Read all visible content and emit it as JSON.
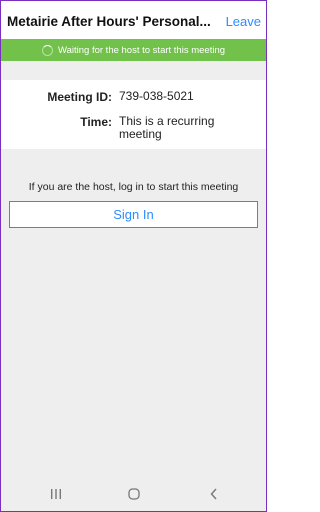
{
  "header": {
    "title": "Metairie After Hours' Personal...",
    "leave_label": "Leave"
  },
  "banner": {
    "status_text": "Waiting for the host to start this meeting",
    "color": "#72c14a"
  },
  "meeting": {
    "id_label": "Meeting ID:",
    "id_value": "739-038-5021",
    "time_label": "Time:",
    "time_value": "This is a recurring meeting"
  },
  "host_prompt": "If you are the host, log in to start this meeting",
  "signin_label": "Sign In",
  "accent_color": "#2d8cff",
  "nav": {
    "icons": [
      "recent-apps-icon",
      "home-icon",
      "back-icon"
    ]
  }
}
